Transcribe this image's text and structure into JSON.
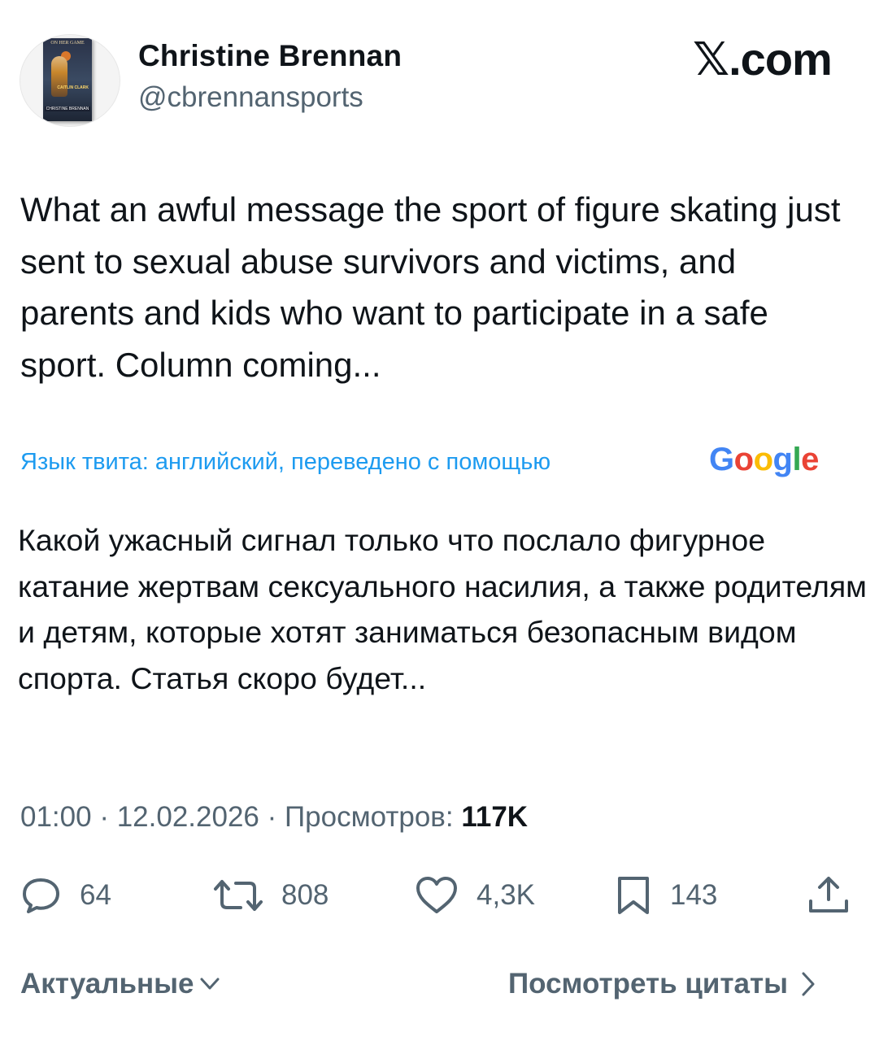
{
  "author": {
    "name": "Christine Brennan",
    "handle": "@cbrennansports",
    "avatar_icon": "book-cover-avatar",
    "avatar_text": {
      "title": "ON HER GAME",
      "subtitle": "CAITLIN CLARK",
      "author": "CHRISTINE BRENNAN"
    }
  },
  "brand": {
    "prefix": "𝕏",
    "suffix": ".com"
  },
  "tweet": {
    "text": "What an awful message the sport of figure skating just sent to sexual abuse survivors and victims, and parents and kids who want to participate in a safe sport. Column coming..."
  },
  "translation": {
    "label": "Язык твита: английский, переведено с помощью",
    "provider": {
      "letters": [
        "G",
        "o",
        "o",
        "g",
        "l",
        "e"
      ],
      "colors": [
        "#4285F4",
        "#EA4335",
        "#FBBC05",
        "#4285F4",
        "#34A853",
        "#EA4335"
      ]
    },
    "text": "Какой ужасный сигнал только что послало фигурное катание жертвам сексуального насилия, а также родителям и детям, которые хотят заниматься безопасным видом спорта. Статья скоро будет..."
  },
  "meta": {
    "time": "01:00",
    "separator": " · ",
    "date": "12.02.2026",
    "views_label": "Просмотров:",
    "views_count": "117K"
  },
  "actions": {
    "replies": "64",
    "retweets": "808",
    "likes": "4,3K",
    "bookmarks": "143"
  },
  "footer": {
    "sort_label": "Актуальные",
    "quotes_label": "Посмотреть цитаты"
  },
  "colors": {
    "text": "#0f1419",
    "secondary": "#536471",
    "link": "#1d9bf0"
  }
}
